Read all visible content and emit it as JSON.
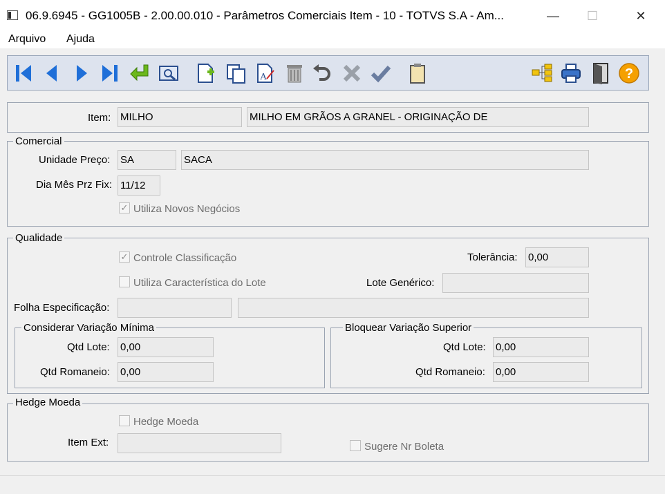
{
  "window": {
    "title": "06.9.6945 - GG1005B - 2.00.00.010 - Parâmetros Comerciais Item - 10 - TOTVS S.A - Am...",
    "minimize_glyph": "—",
    "maximize_glyph": "☐",
    "close_glyph": "✕"
  },
  "menu": {
    "items": [
      "Arquivo",
      "Ajuda"
    ]
  },
  "toolbar": {
    "icons": [
      "first-record-icon",
      "previous-record-icon",
      "next-record-icon",
      "last-record-icon",
      "goto-icon",
      "search-icon",
      "new-record-icon",
      "copy-icon",
      "edit-icon",
      "delete-icon",
      "undo-icon",
      "cancel-icon",
      "save-icon",
      "clipboard-icon",
      "tree-icon",
      "print-icon",
      "exit-door-icon",
      "help-icon"
    ],
    "help_glyph": "?"
  },
  "item": {
    "label": "Item:",
    "code": "MILHO",
    "description": "MILHO EM GRÃOS A GRANEL - ORIGINAÇÃO DE"
  },
  "comercial": {
    "title": "Comercial",
    "unidade_label": "Unidade Preço:",
    "unidade_code": "SA",
    "unidade_desc": "SACA",
    "dia_label": "Dia Mês Prz Fix:",
    "dia_value": "11/12",
    "novos_negocios_label": "Utiliza Novos Negócios",
    "novos_negocios_checked": true
  },
  "qualidade": {
    "title": "Qualidade",
    "controle_label": "Controle Classificação",
    "controle_checked": true,
    "tolerancia_label": "Tolerância:",
    "tolerancia_value": "0,00",
    "caracteristica_label": "Utiliza Característica do Lote",
    "caracteristica_checked": false,
    "lote_generico_label": "Lote Genérico:",
    "lote_generico_value": "",
    "folha_label": "Folha Especificação:",
    "folha_code": "",
    "folha_desc": "",
    "minima": {
      "title": "Considerar Variação Mínima",
      "qtd_lote_label": "Qtd Lote:",
      "qtd_lote_value": "0,00",
      "qtd_romaneio_label": "Qtd Romaneio:",
      "qtd_romaneio_value": "0,00"
    },
    "superior": {
      "title": "Bloquear Variação Superior",
      "qtd_lote_label": "Qtd Lote:",
      "qtd_lote_value": "0,00",
      "qtd_romaneio_label": "Qtd Romaneio:",
      "qtd_romaneio_value": "0,00"
    }
  },
  "hedge": {
    "title": "Hedge Moeda",
    "hedge_label": "Hedge Moeda",
    "hedge_checked": false,
    "item_ext_label": "Item Ext:",
    "item_ext_value": "",
    "boleta_label": "Sugere Nr Boleta",
    "boleta_checked": false
  },
  "colors": {
    "icon_blue": "#1f6fd8",
    "toolbar_bg": "#dde3ee",
    "help_orange": "#f5a000",
    "green_arrow": "#6cb81d"
  }
}
